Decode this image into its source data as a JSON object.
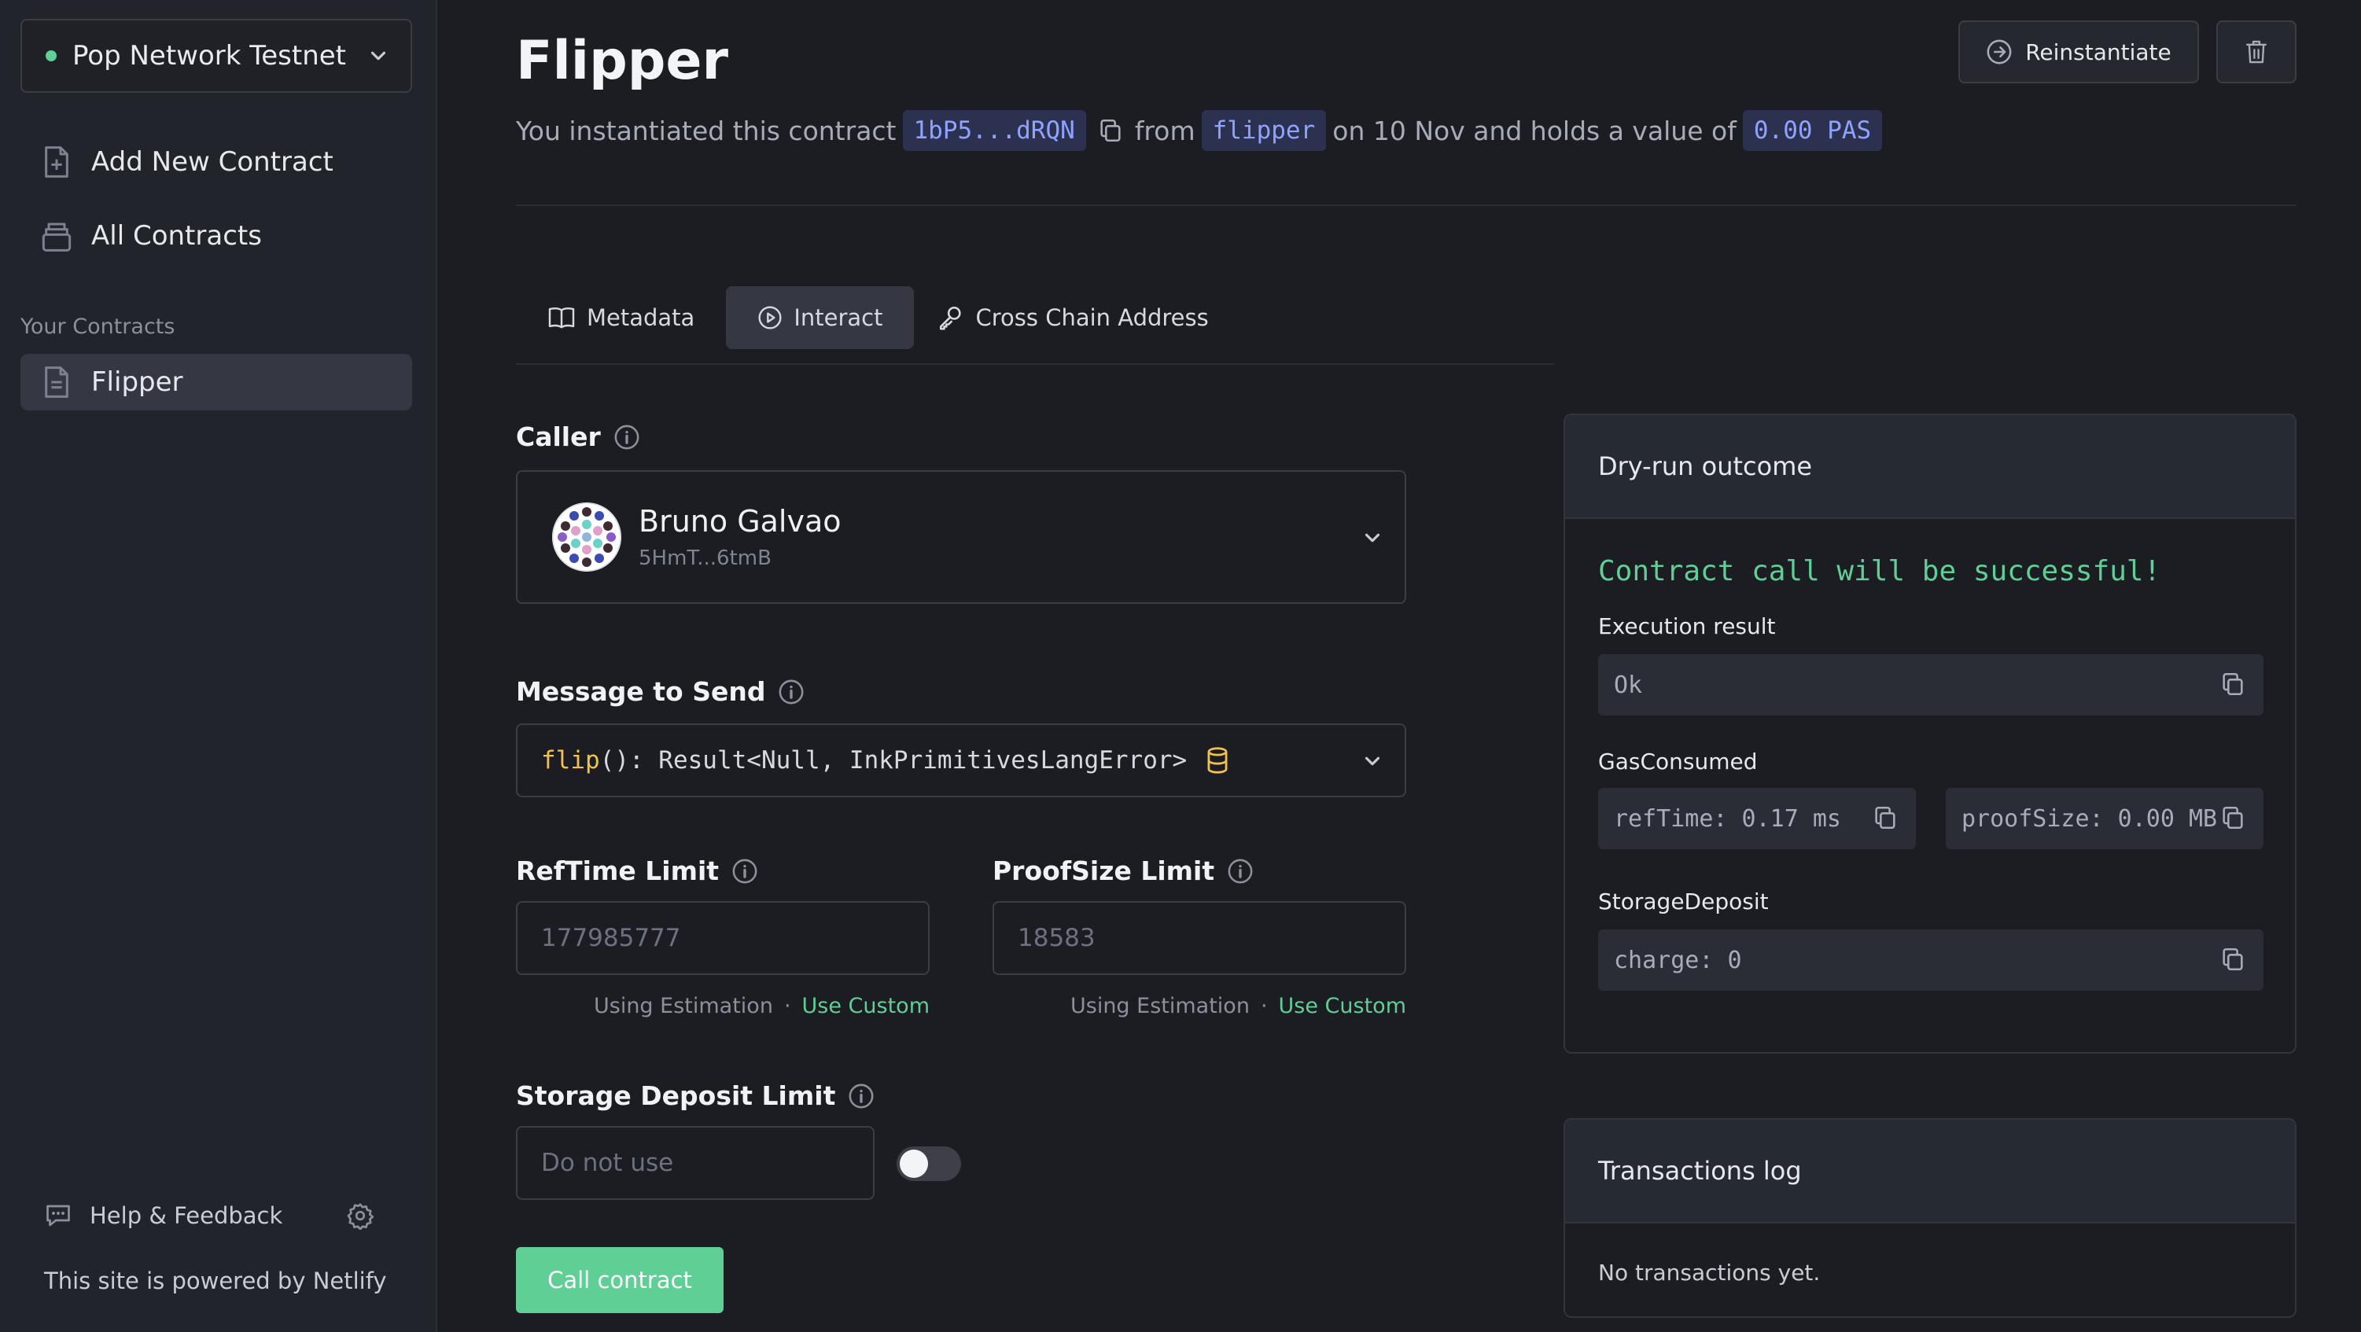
{
  "sidebar": {
    "network": "Pop Network Testnet",
    "items": [
      {
        "label": "Add New Contract",
        "icon": "file-plus-icon"
      },
      {
        "label": "All Contracts",
        "icon": "stack-icon"
      }
    ],
    "section_title": "Your Contracts",
    "contracts": [
      {
        "label": "Flipper",
        "icon": "document-icon"
      }
    ],
    "help": "Help & Feedback",
    "powered": "This site is powered by Netlify"
  },
  "header": {
    "title": "Flipper",
    "subtitle": {
      "prefix": "You instantiated this contract",
      "address": "1bP5...dRQN",
      "from": "from",
      "code": "flipper",
      "on": "on 10 Nov and holds a value of",
      "value": "0.00 PAS"
    },
    "reinstantiate": "Reinstantiate"
  },
  "tabs": [
    {
      "label": "Metadata",
      "icon": "book-icon"
    },
    {
      "label": "Interact",
      "icon": "play-circle-icon",
      "active": true
    },
    {
      "label": "Cross Chain Address",
      "icon": "key-icon"
    }
  ],
  "form": {
    "caller_label": "Caller",
    "caller": {
      "name": "Bruno Galvao",
      "address": "5HmT...6tmB"
    },
    "message_label": "Message to Send",
    "message": {
      "fn": "flip",
      "rest": "(): Result<Null, InkPrimitivesLangError>"
    },
    "reftime_label": "RefTime Limit",
    "reftime_placeholder": "177985777",
    "proofsize_label": "ProofSize Limit",
    "proofsize_placeholder": "18583",
    "using_estimation": "Using Estimation",
    "sep": "·",
    "use_custom": "Use Custom",
    "storage_label": "Storage Deposit Limit",
    "storage_placeholder": "Do not use",
    "call_button": "Call contract"
  },
  "dryrun": {
    "title": "Dry-run outcome",
    "status": "Contract call will be successful!",
    "execution_label": "Execution result",
    "execution_value": "Ok",
    "gas_label": "GasConsumed",
    "reftime": "refTime: 0.17 ms",
    "proofsize": "proofSize: 0.00 MB",
    "storage_label": "StorageDeposit",
    "storage_value": "charge: 0"
  },
  "txlog": {
    "title": "Transactions log",
    "empty": "No transactions yet."
  },
  "colors": {
    "accent_green": "#5fcf95",
    "chip_bg": "#2c3150",
    "chip_text": "#8ea3ff",
    "message_fn": "#f2c14e"
  }
}
